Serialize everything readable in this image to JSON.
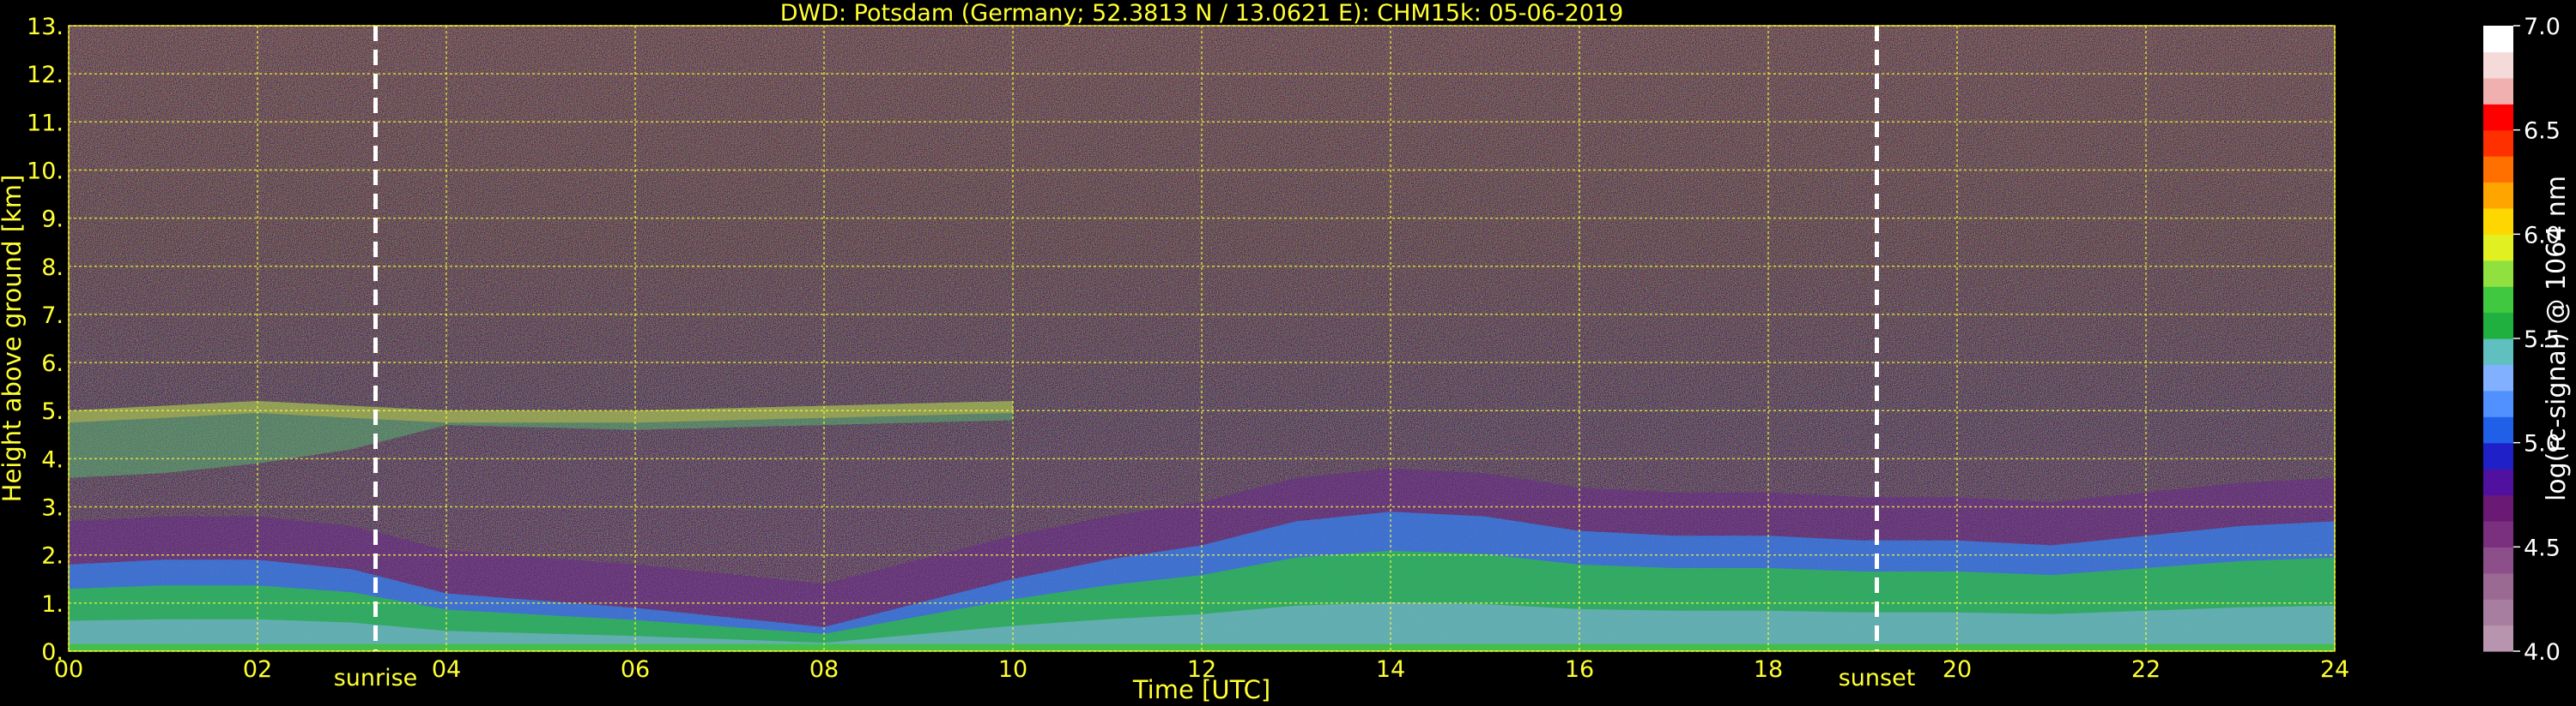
{
  "chart_data": {
    "type": "heatmap",
    "title": "DWD: Potsdam (Germany; 52.3813 N / 13.0621 E):    CHM15k: 05-06-2019",
    "xlabel": "Time [UTC]",
    "ylabel": "Height above ground [km]",
    "xlim": [
      0,
      24
    ],
    "ylim": [
      0,
      13
    ],
    "x_ticks": [
      "00",
      "02",
      "04",
      "06",
      "08",
      "10",
      "12",
      "14",
      "16",
      "18",
      "20",
      "22",
      "24"
    ],
    "y_ticks": [
      "0.",
      "1.",
      "2.",
      "3.",
      "4.",
      "5.",
      "6.",
      "7.",
      "8.",
      "9.",
      "10.",
      "11.",
      "12.",
      "13."
    ],
    "grid": true,
    "markers": [
      {
        "label": "sunrise",
        "x": 3.25
      },
      {
        "label": "sunset",
        "x": 19.15
      }
    ],
    "colorbar": {
      "label": "log(rc-signal) @ 1064 nm",
      "range": [
        4.0,
        7.0
      ],
      "ticks": [
        "4.0",
        "4.5",
        "5.0",
        "5.5",
        "6.0",
        "6.5",
        "7.0"
      ],
      "colors": [
        "#b895ae",
        "#a87ea0",
        "#9a6a93",
        "#8c4f8a",
        "#7a2f7f",
        "#6a1a75",
        "#5010a0",
        "#2020c8",
        "#2060e8",
        "#5090ff",
        "#80b0ff",
        "#60c0c0",
        "#20b040",
        "#40c840",
        "#90e040",
        "#e0f020",
        "#ffd700",
        "#ffa500",
        "#ff7000",
        "#ff3000",
        "#ff0000",
        "#f0b0b0",
        "#f5dada",
        "#ffffff"
      ]
    },
    "layers": [
      {
        "name": "surface",
        "x": [
          0,
          24
        ],
        "bottom": 0.0,
        "top": 0.15,
        "value": 5.4
      },
      {
        "name": "boundary-layer",
        "x": [
          0,
          1,
          2,
          3,
          4,
          6,
          8,
          9,
          10,
          11,
          12,
          13,
          14,
          15,
          16,
          17,
          18,
          19,
          20,
          21,
          22,
          23,
          24
        ],
        "top": [
          1.8,
          1.9,
          1.9,
          1.7,
          1.2,
          0.9,
          0.5,
          1.0,
          1.5,
          1.9,
          2.2,
          2.7,
          2.9,
          2.8,
          2.5,
          2.4,
          2.4,
          2.3,
          2.3,
          2.2,
          2.4,
          2.6,
          2.7
        ]
      },
      {
        "name": "aerosol-layer-upper",
        "x": [
          0,
          1,
          2,
          3,
          4,
          6,
          8,
          10
        ],
        "bottom": [
          3.6,
          3.7,
          3.9,
          4.2,
          4.7,
          4.6,
          4.7,
          4.8
        ],
        "top": [
          5.0,
          5.1,
          5.2,
          5.1,
          5.0,
          5.0,
          5.1,
          5.2
        ]
      }
    ]
  }
}
